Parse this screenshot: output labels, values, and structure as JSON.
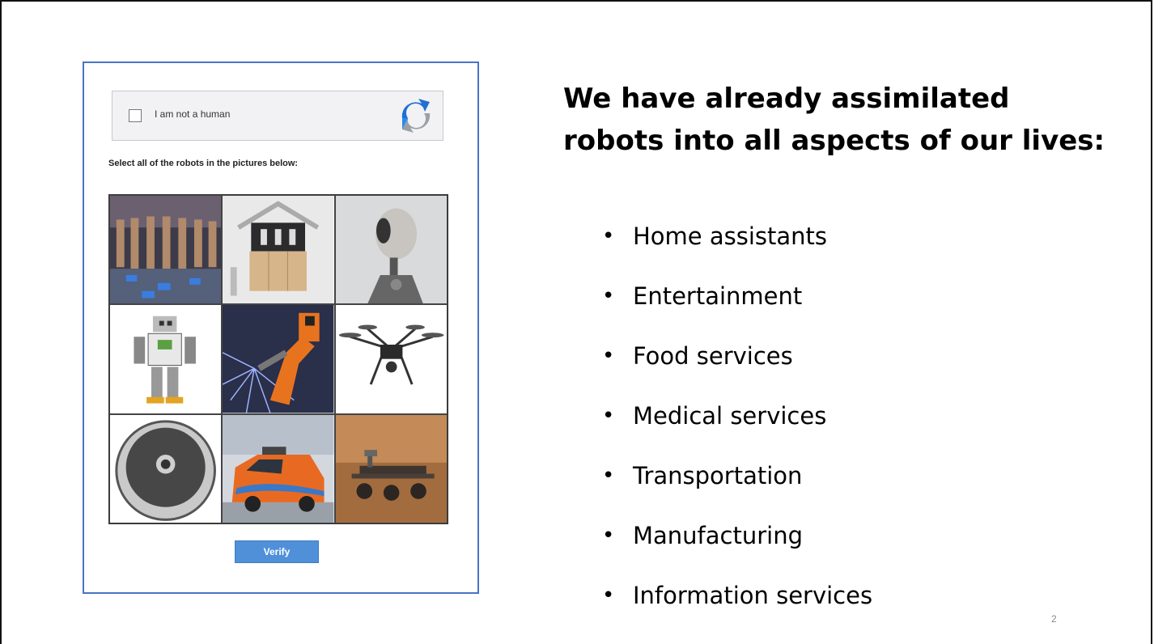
{
  "captcha": {
    "checkbox_label": "I am not a human",
    "instruction": "Select all of the robots in the pictures below:",
    "verify_label": "Verify",
    "tiles": [
      "warehouse-robots-image",
      "robotic-arms-booth-image",
      "humanoid-head-robot-image",
      "toy-humanoid-robot-image",
      "welding-robot-image",
      "drone-image",
      "robot-vacuum-image",
      "self-driving-van-image",
      "mars-rover-image"
    ],
    "accent_color": "#4a73c4",
    "button_color": "#4f90d9"
  },
  "slide": {
    "heading_line1": "We have already assimilated",
    "heading_line2": "robots into all aspects of our lives:",
    "bullets": [
      "Home assistants",
      "Entertainment",
      "Food services",
      "Medical services",
      "Transportation",
      "Manufacturing",
      "Information services"
    ],
    "page_number": "2"
  }
}
